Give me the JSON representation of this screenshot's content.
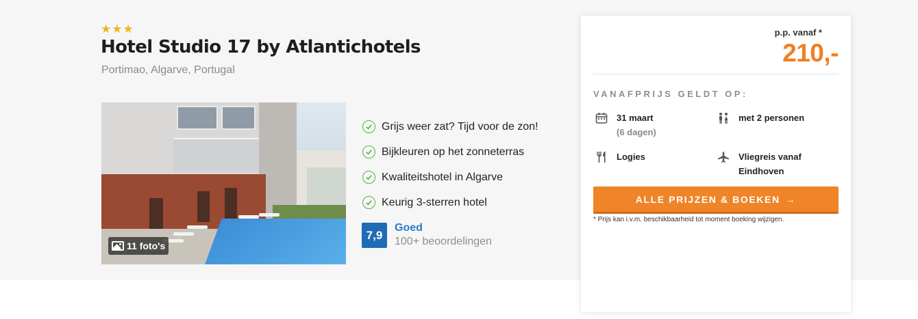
{
  "hotel": {
    "stars": 3,
    "name": "Hotel Studio 17 by Atlantichotels",
    "location": "Portimao, Algarve, Portugal",
    "photo_count": "11 foto's"
  },
  "usps": [
    "Grijs weer zat? Tijd voor de zon!",
    "Bijkleuren op het zonneterras",
    "Kwaliteitshotel in Algarve",
    "Keurig 3-sterren hotel"
  ],
  "rating": {
    "score": "7,9",
    "label": "Goed",
    "count": "100+ beoordelingen"
  },
  "pricing": {
    "from_label": "p.p. vanaf *",
    "price": "210,-",
    "valid_label": "VANAFPRIJS GELDT OP:",
    "date": "31 maart",
    "duration": "(6 dagen)",
    "persons": "met 2 personen",
    "board": "Logies",
    "travel": "Vliegreis vanaf",
    "departure": "Eindhoven",
    "button_label": "ALLE PRIJZEN & BOEKEN",
    "disclaimer": "* Prijs kan i.v.m. beschikbaarheid tot moment boeking wijzigen."
  },
  "colors": {
    "accent": "#f08428",
    "price": "#f07f22",
    "rating": "#1f6bb8",
    "check": "#4fb33a",
    "stars": "#f2b21b"
  },
  "icons": [
    "star-icon",
    "image-icon",
    "check-circle-icon",
    "calendar-icon",
    "persons-icon",
    "cutlery-icon",
    "plane-icon",
    "arrow-right-icon"
  ]
}
